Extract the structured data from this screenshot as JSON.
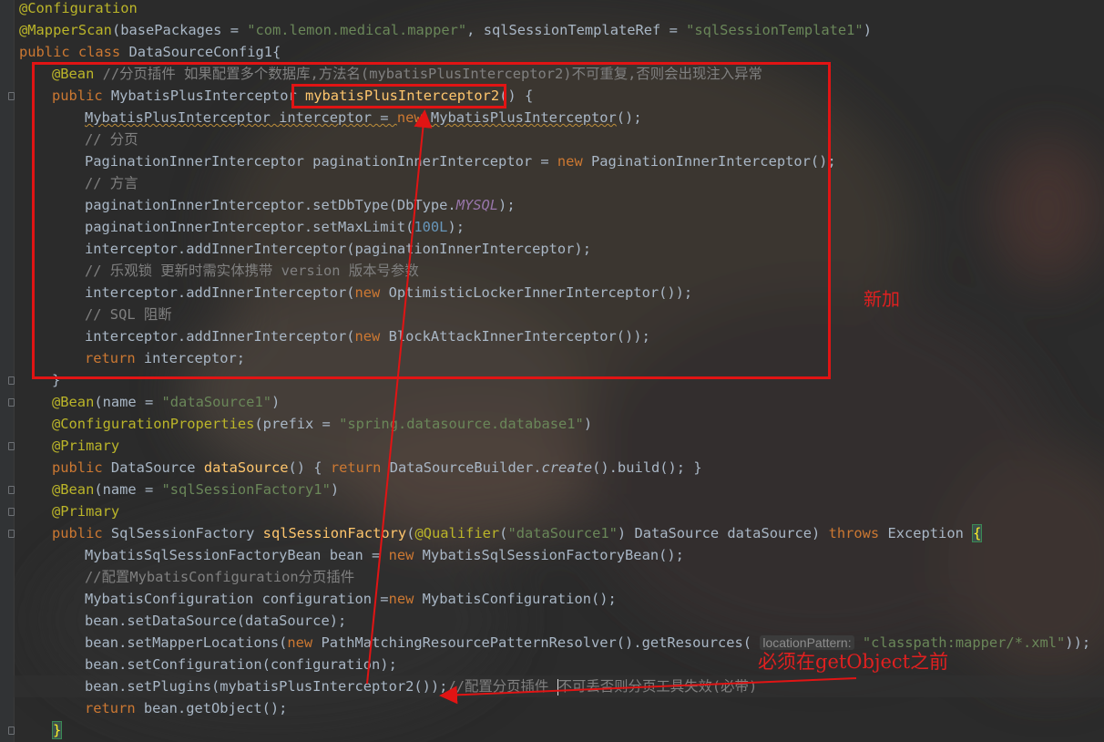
{
  "code": {
    "l1": {
      "ann": "@Configuration"
    },
    "l2": {
      "ann": "@MapperScan",
      "open": "(",
      "attr1": "basePackages",
      "eq1": " = ",
      "val1": "\"com.lemon.medical.mapper\"",
      "comma": ", ",
      "attr2": "sqlSessionTemplateRef",
      "eq2": " = ",
      "val2": "\"sqlSessionTemplate1\"",
      "close": ")"
    },
    "l3": {
      "kw1": "public class ",
      "name": "DataSourceConfig1",
      "brace": "{"
    },
    "l4": {
      "ann": "@Bean",
      "comment": " //分页插件 如果配置多个数据库,方法名(mybatisPlusInterceptor2)不可重复,否则会出现注入异常"
    },
    "l5": {
      "kw": "public ",
      "type": "MybatisPlusInterceptor ",
      "method": "mybatisPlusInterceptor2",
      "paren": "()",
      "brace": " {"
    },
    "l6": {
      "decl": "MybatisPlusInterceptor interceptor = ",
      "kw": "new ",
      "ctor": "MybatisPlusInterceptor",
      "end": "();"
    },
    "l7": {
      "comment": "// 分页"
    },
    "l8": {
      "decl": "PaginationInnerInterceptor paginationInnerInterceptor = ",
      "kw": "new ",
      "ctor": "PaginationInnerInterceptor",
      "end": "();"
    },
    "l9": {
      "comment": "// 方言"
    },
    "l10": {
      "pre": "paginationInnerInterceptor.setDbType(DbType.",
      "field": "MYSQL",
      "end": ");"
    },
    "l11": {
      "pre": "paginationInnerInterceptor.setMaxLimit(",
      "num": "100L",
      "end": ");"
    },
    "l12": {
      "text": "interceptor.addInnerInterceptor(paginationInnerInterceptor);"
    },
    "l13": {
      "comment": "// 乐观锁 更新时需实体携带 version 版本号参数"
    },
    "l14": {
      "pre": "interceptor.addInnerInterceptor(",
      "kw": "new ",
      "post": "OptimisticLockerInnerInterceptor());"
    },
    "l15": {
      "comment": "// SQL 阻断"
    },
    "l16": {
      "pre": "interceptor.addInnerInterceptor(",
      "kw": "new ",
      "post": "BlockAttackInnerInterceptor());"
    },
    "l17": {
      "kw": "return ",
      "post": "interceptor;"
    },
    "l18": {
      "brace": "}"
    },
    "l19": {
      "ann": "@Bean",
      "open": "(",
      "attr": "name",
      "eq": " = ",
      "val": "\"dataSource1\"",
      "close": ")"
    },
    "l20": {
      "ann": "@ConfigurationProperties",
      "open": "(",
      "attr": "prefix",
      "eq": " = ",
      "val": "\"spring.datasource.database1\"",
      "close": ")"
    },
    "l21": {
      "ann": "@Primary"
    },
    "l22": {
      "kw": "public ",
      "type": "DataSource ",
      "method": "dataSource",
      "mid": "() ",
      "lb": "{",
      "kw2": " return ",
      "pre": "DataSourceBuilder.",
      "ital": "create",
      "post": "().build(); ",
      "rb": "}"
    },
    "l23": {
      "ann": "@Bean",
      "open": "(",
      "attr": "name",
      "eq": " = ",
      "val": "\"sqlSessionFactory1\"",
      "close": ")"
    },
    "l24": {
      "ann": "@Primary"
    },
    "l25": {
      "kw": "public ",
      "type": "SqlSessionFactory ",
      "method": "sqlSessionFactory",
      "open": "(",
      "ann": "@Qualifier",
      "aopen": "(",
      "val": "\"dataSource1\"",
      "aclose": ") ",
      "param": "DataSource dataSource) ",
      "kw2": "throws ",
      "exc": "Exception ",
      "brace": "{"
    },
    "l26": {
      "decl": "MybatisSqlSessionFactoryBean bean = ",
      "kw": "new ",
      "post": "MybatisSqlSessionFactoryBean();"
    },
    "l27": {
      "comment": "//配置MybatisConfiguration分页插件"
    },
    "l28": {
      "decl": "MybatisConfiguration configuration =",
      "kw": "new ",
      "post": "MybatisConfiguration();"
    },
    "l29": {
      "text": "bean.setDataSource(dataSource);"
    },
    "l30": {
      "pre": "bean.setMapperLocations(",
      "kw": "new ",
      "mid": "PathMatchingResourcePatternResolver().getResources(",
      "hint": "locationPattern:",
      "val": "\"classpath:mapper/*.xml\"",
      "end": "));"
    },
    "l31": {
      "text": "bean.setConfiguration(configuration);"
    },
    "l32": {
      "pre": "bean.setPlugins(mybatisPlusInterceptor2());",
      "comment1": "//配置分页插件 ",
      "comment2": "不可丢否则分页工具失效(必带)"
    },
    "l33": {
      "kw": "return ",
      "post": "bean.getObject();"
    },
    "l34": {
      "brace": "}"
    }
  },
  "annotations": {
    "new_label": "新加",
    "before_label": "必须在getObject之前",
    "red_color": "#e11414"
  }
}
